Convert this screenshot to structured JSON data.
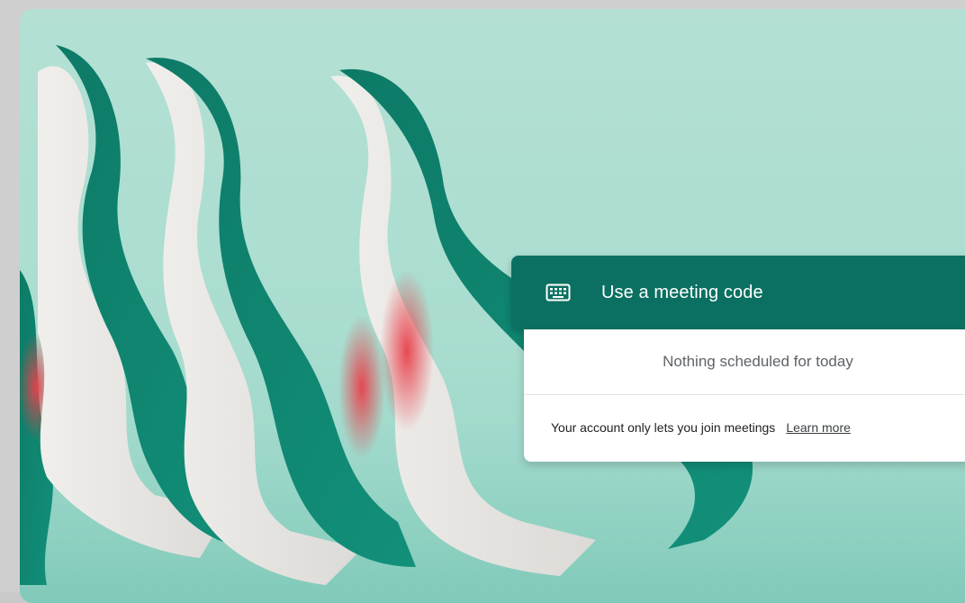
{
  "meeting_code": {
    "icon": "keyboard-icon",
    "label": "Use a meeting code"
  },
  "schedule": {
    "status_text": "Nothing scheduled for today"
  },
  "account_notice": {
    "text": "Your account only lets you join meetings",
    "link_text": "Learn more"
  },
  "colors": {
    "background": "#aadccf",
    "accent": "#0b7061",
    "ribbon_green": "#0f7f6a",
    "paper_white": "#e9e7e4",
    "shadow_red": "#e0474f"
  }
}
